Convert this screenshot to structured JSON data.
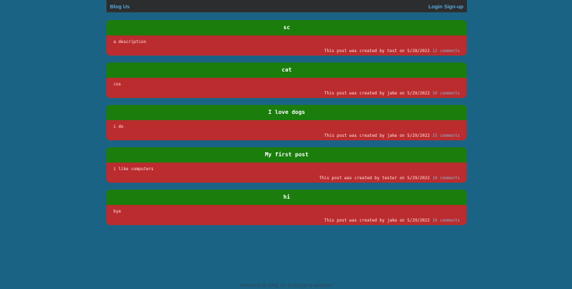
{
  "nav": {
    "brand": "Blog Us",
    "login": "Login",
    "signup": "Sign-up"
  },
  "posts": [
    {
      "title": "sc",
      "description": "a description",
      "meta": "This post was created by test on 5/28/2022",
      "comments": "12 comments"
    },
    {
      "title": "cat",
      "description": "cos",
      "meta": "This post was created by jake on 5/29/2022",
      "comments": "10 comments"
    },
    {
      "title": "I love dogs",
      "description": "i do",
      "meta": "This post was created by jake on 5/29/2022",
      "comments": "15 comments"
    },
    {
      "title": "My first post",
      "description": "i like computers",
      "meta": "This post was created by tester on 5/29/2022",
      "comments": "10 comments"
    },
    {
      "title": "hi",
      "description": "bye",
      "meta": "This post was created by jake on 5/29/2022",
      "comments": "10 comments"
    }
  ],
  "footer": {
    "text": "Welcome to Blog Us a blogging website!"
  },
  "colors": {
    "page_background": "#1b6385",
    "navbar": "#2b2d2e",
    "post_header": "#1b7d0c",
    "post_body": "#bb2c2e",
    "link": "#5aa8d9"
  }
}
